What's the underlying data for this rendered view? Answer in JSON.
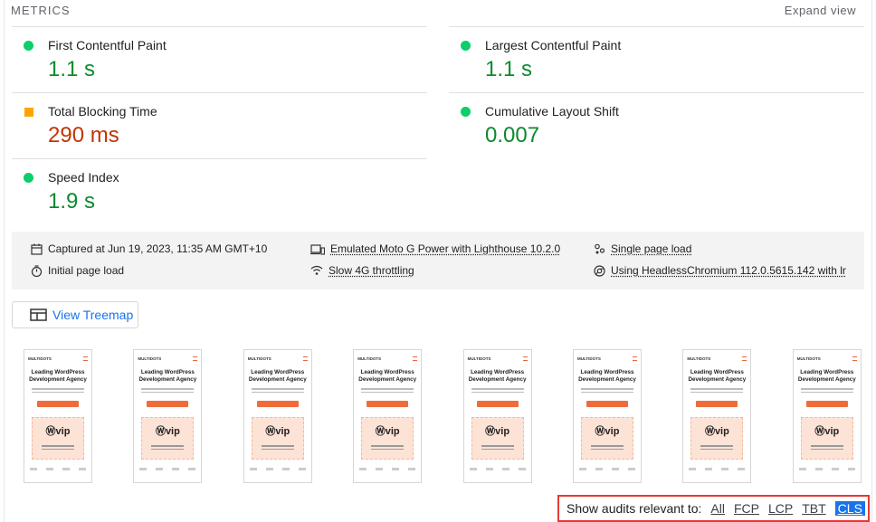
{
  "header": {
    "title": "METRICS",
    "expand": "Expand view"
  },
  "metrics": [
    {
      "name": "First Contentful Paint",
      "value": "1.1 s",
      "status": "pass",
      "color": "#0c8a2f",
      "indicator": "#0cce6b"
    },
    {
      "name": "Largest Contentful Paint",
      "value": "1.1 s",
      "status": "pass",
      "color": "#0c8a2f",
      "indicator": "#0cce6b"
    },
    {
      "name": "Total Blocking Time",
      "value": "290 ms",
      "status": "average",
      "color": "#c33300",
      "indicator": "#ffa400"
    },
    {
      "name": "Cumulative Layout Shift",
      "value": "0.007",
      "status": "pass",
      "color": "#0c8a2f",
      "indicator": "#0cce6b"
    },
    {
      "name": "Speed Index",
      "value": "1.9 s",
      "status": "pass",
      "color": "#0c8a2f",
      "indicator": "#0cce6b"
    }
  ],
  "run_info": {
    "captured": "Captured at Jun 19, 2023, 11:35 AM GMT+10",
    "initial_load": "Initial page load",
    "device": "Emulated Moto G Power with Lighthouse 10.2.0",
    "throttling": "Slow 4G throttling",
    "session": "Single page load",
    "browser": "Using HeadlessChromium 112.0.5615.142 with lr"
  },
  "treemap_button": "View Treemap",
  "filmstrip": {
    "count": 8,
    "logo": "MULTIDOTS",
    "headline": "Leading WordPress Development Agency",
    "badge": "vip"
  },
  "audit_filter": {
    "label": "Show audits relevant to:",
    "options": [
      "All",
      "FCP",
      "LCP",
      "TBT",
      "CLS"
    ],
    "selected": "CLS"
  }
}
